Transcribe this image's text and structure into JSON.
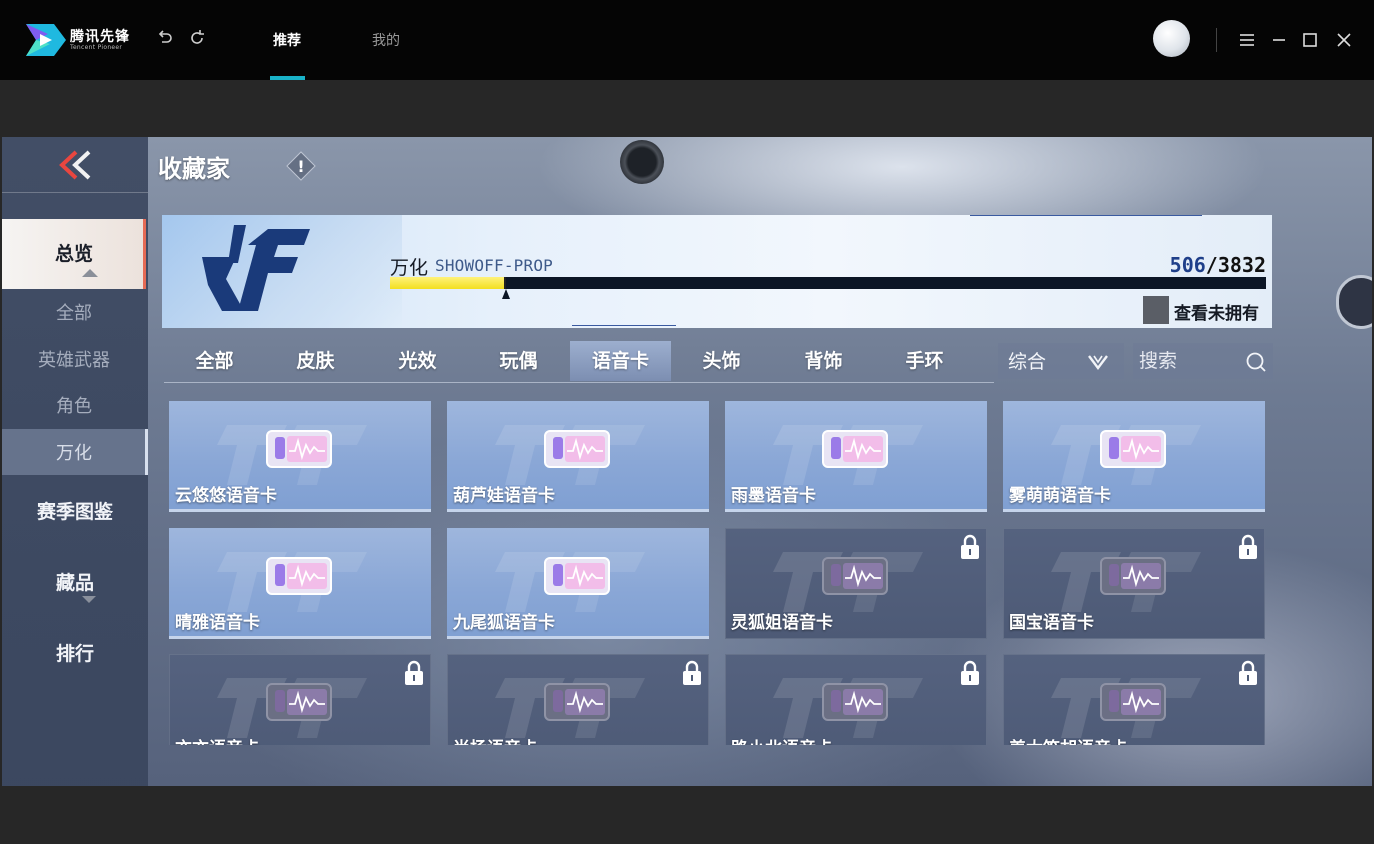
{
  "app": {
    "name": "腾讯先锋",
    "name_sub": "Tencent Pioneer",
    "tabs": [
      {
        "label": "推荐",
        "active": true
      },
      {
        "label": "我的",
        "active": false
      }
    ],
    "accent_color": "#19b2c8"
  },
  "sidebar": {
    "overview": "总览",
    "sub_items": [
      {
        "label": "全部",
        "active": false
      },
      {
        "label": "英雄武器",
        "active": false
      },
      {
        "label": "角色",
        "active": false
      },
      {
        "label": "万化",
        "active": true
      }
    ],
    "main_items": [
      "赛季图鉴",
      "藏品",
      "排行"
    ]
  },
  "header": {
    "title": "收藏家",
    "info_symbol": "!"
  },
  "banner": {
    "category": "万化",
    "subtitle": "SHOWOFF-PROP",
    "owned": "506",
    "total": "/3832",
    "progress": 0.132,
    "view_unowned": "查看未拥有"
  },
  "filter_tabs": [
    {
      "label": "全部",
      "active": false
    },
    {
      "label": "皮肤",
      "active": false
    },
    {
      "label": "光效",
      "active": false
    },
    {
      "label": "玩偶",
      "active": false
    },
    {
      "label": "语音卡",
      "active": true
    },
    {
      "label": "头饰",
      "active": false
    },
    {
      "label": "背饰",
      "active": false
    },
    {
      "label": "手环",
      "active": false
    }
  ],
  "sort": {
    "label": "综合"
  },
  "search": {
    "placeholder": "搜索"
  },
  "items": [
    {
      "name": "云悠悠语音卡",
      "owned": true
    },
    {
      "name": "葫芦娃语音卡",
      "owned": true
    },
    {
      "name": "雨墨语音卡",
      "owned": true
    },
    {
      "name": "雾萌萌语音卡",
      "owned": true
    },
    {
      "name": "晴雅语音卡",
      "owned": true
    },
    {
      "name": "九尾狐语音卡",
      "owned": true
    },
    {
      "name": "灵狐姐语音卡",
      "owned": false
    },
    {
      "name": "国宝语音卡",
      "owned": false
    },
    {
      "name": "亦亦语音卡",
      "owned": false
    },
    {
      "name": "尚扬语音卡",
      "owned": false
    },
    {
      "name": "路小北语音卡",
      "owned": false
    },
    {
      "name": "姜太笛胡语音卡",
      "owned": false
    }
  ]
}
